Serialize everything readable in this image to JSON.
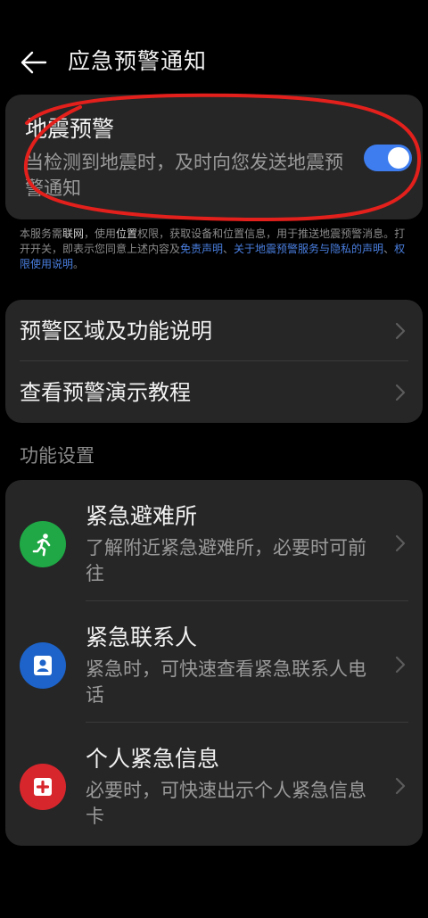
{
  "header": {
    "title": "应急预警通知"
  },
  "earthquake": {
    "title": "地震预警",
    "description": "当检测到地震时，及时向您发送地震预警通知",
    "toggle_on": true
  },
  "notice": {
    "p1": "本服务需",
    "p2": "联网",
    "p3": "，使用",
    "p4": "位置",
    "p5": "权限，获取设备和位置信息，用于推送地震预警消息。打开开关，即表示您同意上述内容及",
    "link1": "免责声明",
    "p6": "、",
    "link2": "关于地震预警服务与隐私的声明",
    "p7": "、",
    "link3": "权限使用说明",
    "p8": "。"
  },
  "guide": {
    "items": [
      {
        "label": "预警区域及功能说明"
      },
      {
        "label": "查看预警演示教程"
      }
    ]
  },
  "section": {
    "label": "功能设置"
  },
  "functions": {
    "items": [
      {
        "title": "紧急避难所",
        "description": "了解附近紧急避难所，必要时可前往",
        "icon": "running-person-icon",
        "color": "#1fa845"
      },
      {
        "title": "紧急联系人",
        "description": "紧急时，可快速查看紧急联系人电话",
        "icon": "person-icon",
        "color": "#1d63c9"
      },
      {
        "title": "个人紧急信息",
        "description": "必要时，可快速出示个人紧急信息卡",
        "icon": "medical-cross-icon",
        "color": "#d8262d"
      }
    ]
  },
  "colors": {
    "toggle": "#3d7df0",
    "link": "#4a7fe0",
    "annotation": "#e3201c"
  }
}
